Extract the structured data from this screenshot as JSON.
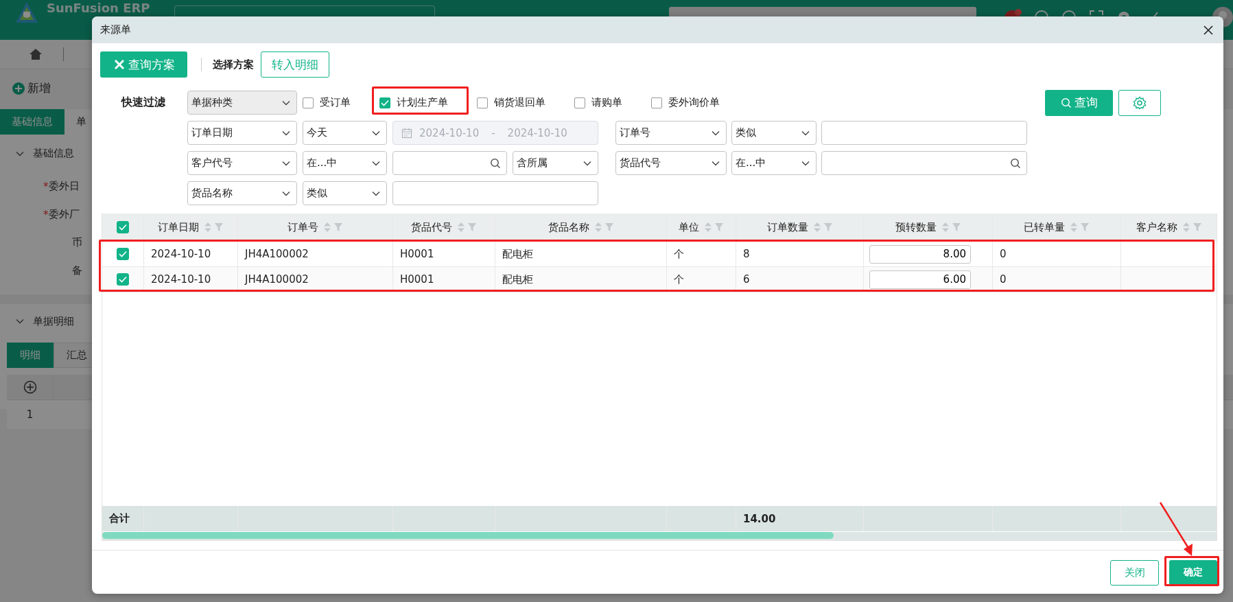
{
  "app": {
    "brand": "SunFusion ERP",
    "new_button": "新增",
    "tabs": [
      {
        "label": "基础信息",
        "selected": true
      },
      {
        "label": "单",
        "selected": false
      }
    ],
    "section_title": "基础信息",
    "fields": [
      {
        "mark": "*",
        "label": "委外日"
      },
      {
        "mark": "*",
        "label": "委外厂"
      },
      {
        "label": "币"
      },
      {
        "label": "备"
      }
    ],
    "detail_title": "单据明细",
    "detail_tabs": [
      {
        "label": "明细",
        "selected": true
      },
      {
        "label": "汇总",
        "selected": false
      }
    ],
    "grid_rows": [
      "1"
    ]
  },
  "dialog": {
    "title": "来源单",
    "scheme_button": "查询方案",
    "scheme_label": "选择方案",
    "detail_button": "转入明细",
    "quick_filter": {
      "label": "快速过滤",
      "type_select": "单据种类",
      "types": [
        {
          "label": "受订单",
          "checked": false
        },
        {
          "label": "计划生产单",
          "checked": true
        },
        {
          "label": "销货退回单",
          "checked": false
        },
        {
          "label": "请购单",
          "checked": false
        },
        {
          "label": "委外询价单",
          "checked": false
        }
      ]
    },
    "query_button": "查询",
    "filter_rows": [
      {
        "left": {
          "field": "订单日期",
          "operator": "今天",
          "value": [
            {
              "kind": "date-range",
              "from": "2024-10-10",
              "separator": "-",
              "to": "2024-10-10",
              "disabled": true
            }
          ]
        },
        "right": {
          "field": "订单号",
          "operator": "类似",
          "value": [
            {
              "kind": "text"
            }
          ]
        }
      },
      {
        "left": {
          "field": "客户代号",
          "operator": "在...中",
          "value": [
            {
              "kind": "lookup"
            },
            {
              "kind": "select",
              "value": "含所属"
            }
          ]
        },
        "right": {
          "field": "货品代号",
          "operator": "在...中",
          "value": [
            {
              "kind": "lookup"
            }
          ]
        }
      },
      {
        "left": {
          "field": "货品名称",
          "operator": "类似",
          "value": [
            {
              "kind": "text"
            }
          ]
        }
      }
    ],
    "table": {
      "all_selected": true,
      "columns": [
        "订单日期",
        "订单号",
        "货品代号",
        "货品名称",
        "单位",
        "订单数量",
        "预转数量",
        "已转单量",
        "客户名称"
      ],
      "rows": [
        {
          "selected": true,
          "cells": [
            "2024-10-10",
            "JH4A100002",
            "H0001",
            "配电柜",
            "个",
            "8",
            "8.00",
            "0"
          ]
        },
        {
          "selected": true,
          "cells": [
            "2024-10-10",
            "JH4A100002",
            "H0001",
            "配电柜",
            "个",
            "6",
            "6.00",
            "0"
          ]
        }
      ],
      "totals": {
        "label": "合计",
        "order_quantity": "14.00"
      }
    },
    "close_button": "关闭",
    "confirm_button": "确定"
  }
}
